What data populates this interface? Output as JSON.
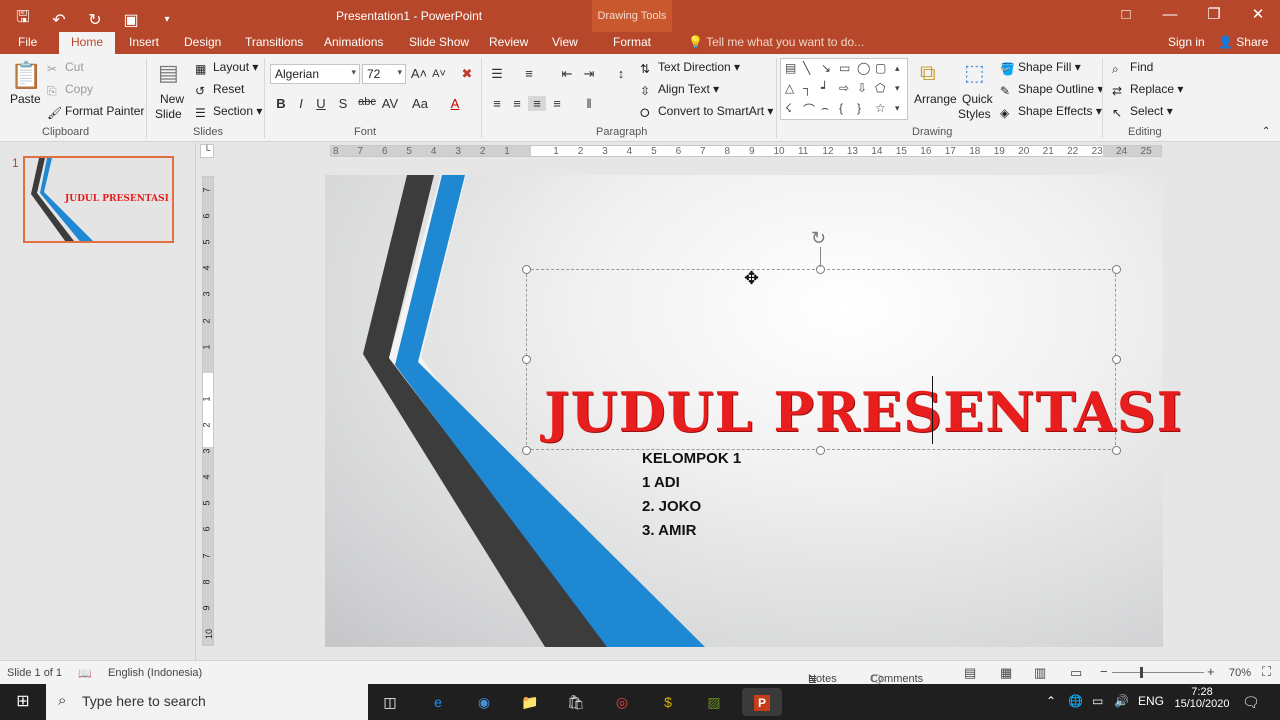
{
  "window": {
    "title": "Presentation1 - PowerPoint",
    "context_group": "Drawing Tools",
    "controls": [
      "restore-ribbon",
      "minimize",
      "maximize",
      "close"
    ]
  },
  "tabs": [
    "File",
    "Home",
    "Insert",
    "Design",
    "Transitions",
    "Animations",
    "Slide Show",
    "Review",
    "View",
    "Format"
  ],
  "active_tab": "Home",
  "tell_me": "Tell me what you want to do...",
  "account": {
    "signin": "Sign in",
    "share": "Share"
  },
  "ribbon": {
    "clipboard": {
      "label": "Clipboard",
      "paste": "Paste",
      "cut": "Cut",
      "copy": "Copy",
      "format_painter": "Format Painter"
    },
    "slides": {
      "label": "Slides",
      "new_slide_1": "New",
      "new_slide_2": "Slide",
      "layout": "Layout",
      "reset": "Reset",
      "section": "Section"
    },
    "font": {
      "label": "Font",
      "family": "Algerian",
      "size": "72"
    },
    "paragraph": {
      "label": "Paragraph",
      "text_direction": "Text Direction",
      "align_text": "Align Text",
      "smartart": "Convert to SmartArt"
    },
    "drawing": {
      "label": "Drawing",
      "arrange": "Arrange",
      "quick_styles_1": "Quick",
      "quick_styles_2": "Styles",
      "shape_fill": "Shape Fill",
      "shape_outline": "Shape Outline",
      "shape_effects": "Shape Effects"
    },
    "editing": {
      "label": "Editing",
      "find": "Find",
      "replace": "Replace",
      "select": "Select"
    }
  },
  "thumbnail": {
    "number": "1",
    "title": "JUDUL PRESENTASI"
  },
  "slide": {
    "title": "JUDUL PRESENTASI",
    "body": [
      "KELOMPOK 1",
      "1  ADI",
      "2. JOKO",
      "3. AMIR"
    ]
  },
  "rulers": {
    "horizontal": [
      "8",
      "7",
      "6",
      "5",
      "4",
      "3",
      "2",
      "1",
      "",
      "1",
      "2",
      "3",
      "4",
      "5",
      "6",
      "7",
      "8",
      "9",
      "10",
      "11",
      "12",
      "13",
      "14",
      "15",
      "16",
      "17",
      "18",
      "19",
      "20",
      "21",
      "22",
      "23",
      "24",
      "25"
    ],
    "vertical": [
      "7",
      "6",
      "5",
      "4",
      "3",
      "2",
      "1",
      "",
      "1",
      "2",
      "3",
      "4",
      "5",
      "6",
      "7",
      "8",
      "9",
      "10"
    ]
  },
  "statusbar": {
    "slide": "Slide 1 of 1",
    "language": "English (Indonesia)",
    "notes": "Notes",
    "comments": "Comments",
    "zoom": "70%"
  },
  "taskbar": {
    "search": "Type here to search",
    "lang": "ENG",
    "time": "7:28",
    "date": "15/10/2020"
  },
  "colors": {
    "accent": "#B7472A",
    "title_red": "#E81E1E",
    "stripe_blue": "#1E88D2",
    "stripe_dark": "#3C3C3C"
  }
}
